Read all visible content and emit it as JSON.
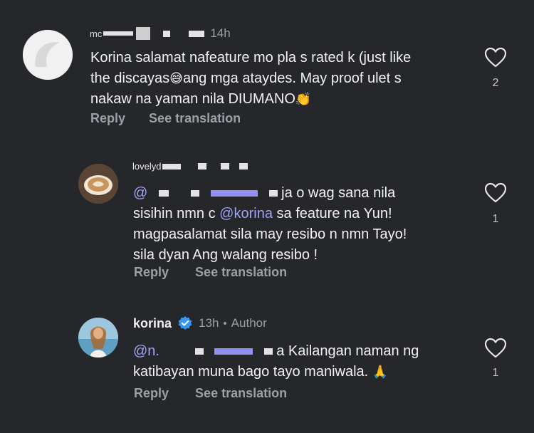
{
  "comments": [
    {
      "username_masked": "mc",
      "time": "14h",
      "text_line1": "Korina salamat nafeature mo pla s rated k (just like",
      "text_line2_a": "the discayas",
      "emoji1": "😅",
      "text_line2_b": "ang mga ataydes. May proof ulet s",
      "text_line3": "nakaw na yaman nila DIUMANO",
      "emoji2": "👏",
      "reply_label": "Reply",
      "translate_label": "See translation",
      "likes": "2"
    },
    {
      "username_masked": "lovelyd",
      "mention_prefix": "@",
      "line1_b": "ja o wag sana nila",
      "line2_a": "sisihin nmn c",
      "line2_mention": "@korina",
      "line2_b": "sa feature na Yun!",
      "line3": "magpasalamat sila may resibo n nmn Tayo!",
      "line4": "sila dyan Ang walang resibo !",
      "reply_label": "Reply",
      "translate_label": "See translation",
      "likes": "1"
    },
    {
      "username": "korina",
      "time": "13h",
      "author_label": "Author",
      "mention_prefix": "@n.",
      "line1_b": "a Kailangan naman ng",
      "line2": "katibayan muna bago tayo maniwala.",
      "emoji": "🙏",
      "reply_label": "Reply",
      "translate_label": "See translation",
      "likes": "1"
    }
  ],
  "colors": {
    "background": "#25272b",
    "mention": "#9fa3f5",
    "verified": "#3897f0",
    "muted": "#9aa0a6"
  }
}
